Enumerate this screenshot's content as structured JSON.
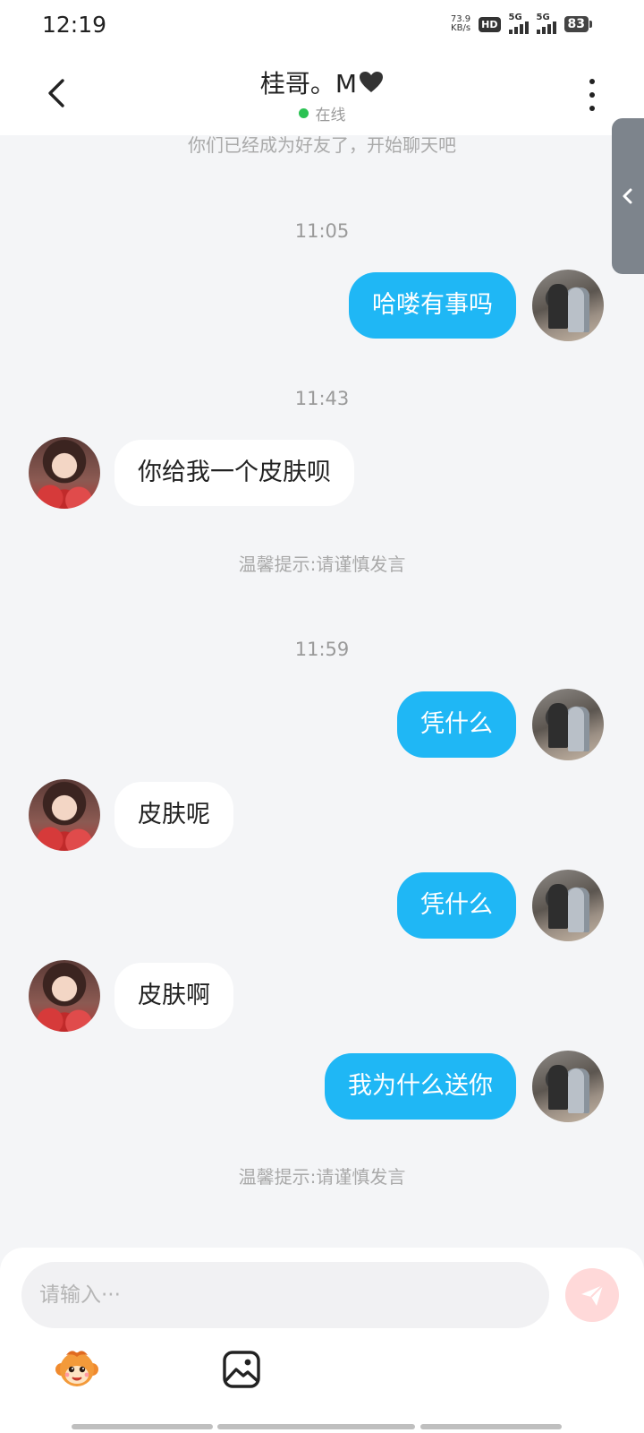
{
  "status_bar": {
    "time": "12:19",
    "net_speed_value": "73.9",
    "net_speed_unit": "KB/s",
    "hd_label": "HD",
    "sim1_label": "5G",
    "sim2_label": "5G",
    "battery": "83"
  },
  "header": {
    "contact_name": "桂哥。M",
    "online_status": "在线"
  },
  "chat": {
    "friend_notice": "你们已经成为好友了，开始聊天吧",
    "time_1": "11:05",
    "msg_1": "哈喽有事吗",
    "time_2": "11:43",
    "msg_2": "你给我一个皮肤呗",
    "warning_1": "温馨提示:请谨慎发言",
    "time_3": "11:59",
    "msg_3": "凭什么",
    "msg_4": "皮肤呢",
    "msg_5": "凭什么",
    "msg_6": "皮肤啊",
    "msg_7": "我为什么送你",
    "warning_2": "温馨提示:请谨慎发言"
  },
  "input": {
    "placeholder": "请输入···"
  },
  "colors": {
    "sent_bubble": "#1fb7f5",
    "online_dot": "#2bc253",
    "send_button": "#ffd9d9"
  }
}
